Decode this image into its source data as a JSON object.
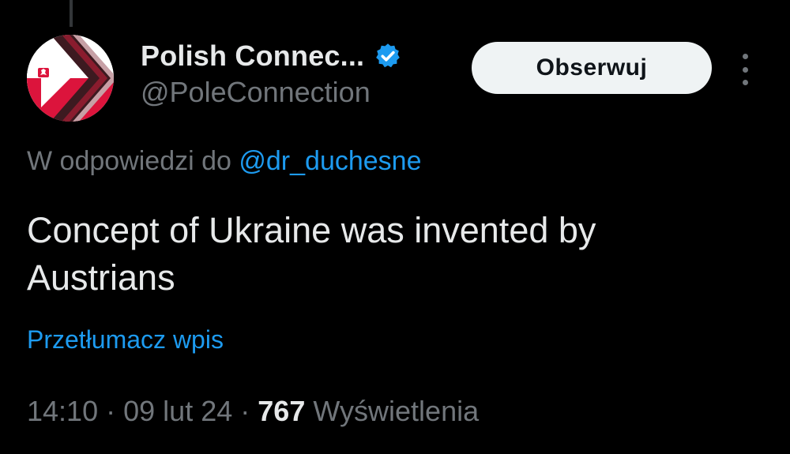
{
  "author": {
    "display_name": "Polish Connec...",
    "handle": "@PoleConnection",
    "verified_icon": "verified-badge-icon",
    "avatar_icon": "polish-flag-chevron-avatar"
  },
  "actions": {
    "follow_label": "Obserwuj",
    "more_icon": "more-vertical-icon"
  },
  "reply": {
    "prefix": "W odpowiedzi do",
    "mention": "@dr_duchesne"
  },
  "tweet": {
    "text": "Concept of Ukraine was invented by Austrians",
    "translate_label": "Przetłumacz wpis"
  },
  "meta": {
    "time": "14:10",
    "separator": "·",
    "date": "09 lut 24",
    "views_count": "767",
    "views_label": "Wyświetlenia"
  },
  "colors": {
    "background": "#000000",
    "primary_text": "#e7e9ea",
    "secondary_text": "#71767b",
    "link_blue": "#1d9bf0",
    "follow_button_bg": "#eff3f4"
  }
}
